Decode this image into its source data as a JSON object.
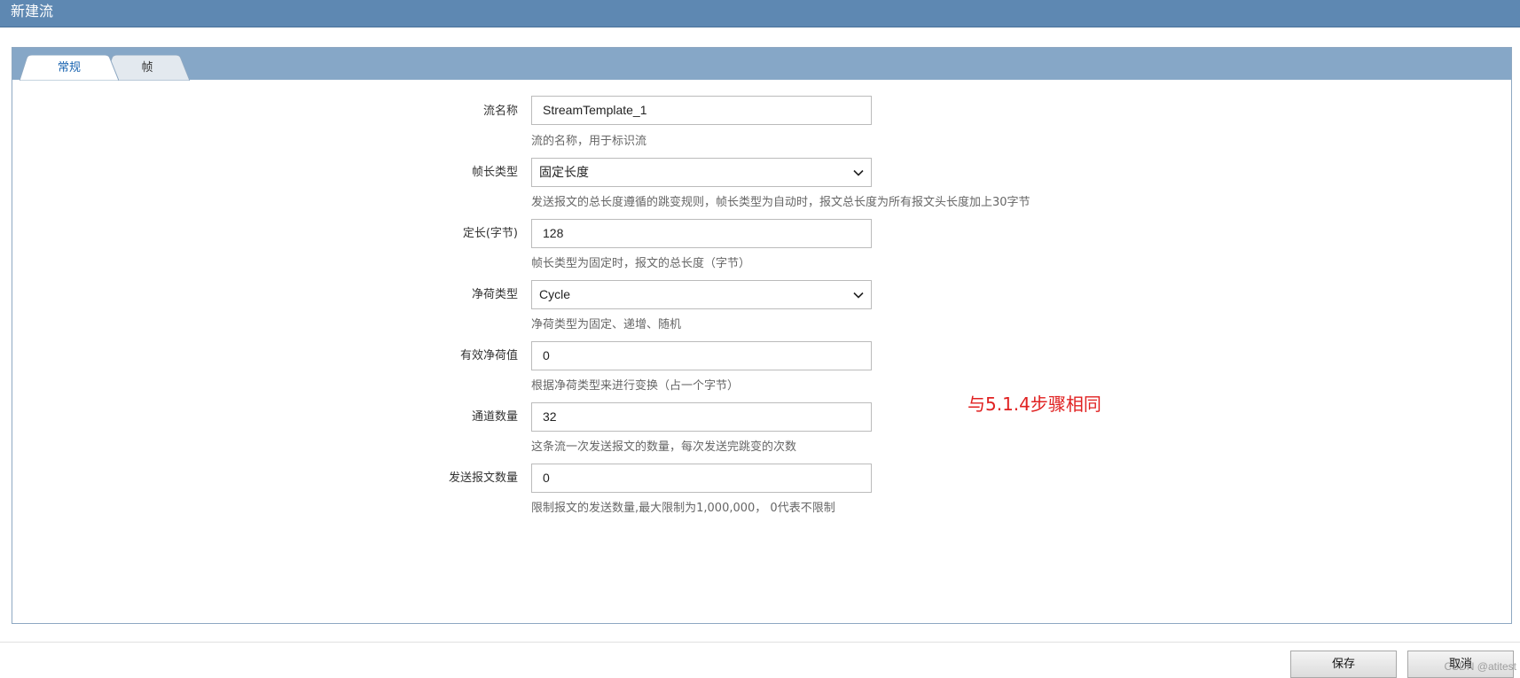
{
  "window": {
    "title": "新建流"
  },
  "tabs": [
    {
      "label": "常规",
      "active": true
    },
    {
      "label": "帧",
      "active": false
    }
  ],
  "form": {
    "stream_name": {
      "label": "流名称",
      "value": "StreamTemplate_1",
      "hint": "流的名称，用于标识流"
    },
    "frame_length_type": {
      "label": "帧长类型",
      "value": "固定长度",
      "hint": "发送报文的总长度遵循的跳变规则，帧长类型为自动时，报文总长度为所有报文头长度加上30字节"
    },
    "fixed_length": {
      "label": "定长(字节)",
      "value": "128",
      "hint": "帧长类型为固定时，报文的总长度（字节）"
    },
    "payload_type": {
      "label": "净荷类型",
      "value": "Cycle",
      "hint": "净荷类型为固定、递增、随机"
    },
    "payload_value": {
      "label": "有效净荷值",
      "value": "0",
      "hint": "根据净荷类型来进行变换（占一个字节）"
    },
    "channel_count": {
      "label": "通道数量",
      "value": "32",
      "hint": "这条流一次发送报文的数量，每次发送完跳变的次数"
    },
    "send_count": {
      "label": "发送报文数量",
      "value": "0",
      "hint": "限制报文的发送数量,最大限制为1,000,000， 0代表不限制"
    }
  },
  "annotation": "与5.1.4步骤相同",
  "buttons": {
    "save": "保存",
    "cancel": "取消"
  },
  "watermark": "CSDN @atitest",
  "colors": {
    "titlebar": "#5e88b2",
    "tabstrip": "#86a7c7",
    "active_tab_text": "#1a64b0",
    "annotation": "#e02020"
  }
}
